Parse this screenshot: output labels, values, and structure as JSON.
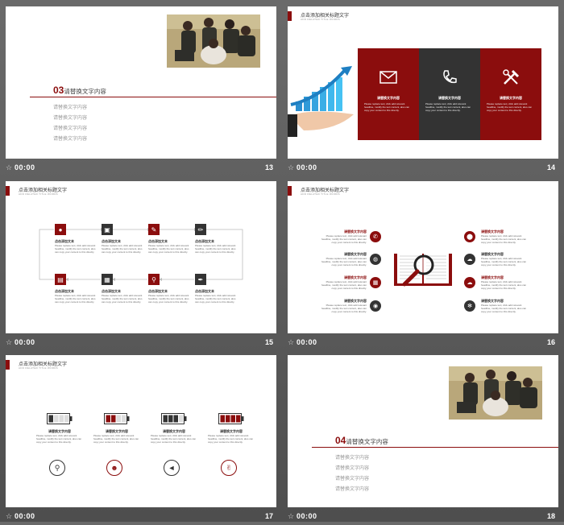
{
  "slides": [
    {
      "number": "13",
      "time": "00:00",
      "section_number": "03",
      "section_title": "请替换文字内容",
      "items": [
        "请替换文字内容",
        "请替换文字内容",
        "请替换文字内容",
        "请替换文字内容"
      ]
    },
    {
      "number": "14",
      "time": "00:00",
      "cards": [
        {
          "icon": "envelope-icon",
          "title": "请替换文字内容",
          "body": "Please replace text, click add relevant headline, modify the text content, also can copy your content to this directly."
        },
        {
          "icon": "phone-icon",
          "title": "请替换文字内容",
          "body": "Please replace text, click add relevant headline, modify the text content, also can copy your content to this directly."
        },
        {
          "icon": "tools-icon",
          "title": "请替换文字内容",
          "body": "Please replace text, click add relevant headline, modify the text content, also can copy your content to this directly."
        }
      ]
    },
    {
      "number": "15",
      "time": "00:00",
      "title": "点击添加相关标题文字",
      "subtitle": "ADD RELATED TITLE WORDS",
      "items": [
        {
          "icon": "user-icon",
          "text": "点击添加文本"
        },
        {
          "icon": "lock-icon",
          "text": "点击添加文本"
        },
        {
          "icon": "wrench-icon",
          "text": "点击添加文本"
        },
        {
          "icon": "pencil-icon",
          "text": "点击添加文本"
        },
        {
          "icon": "briefcase-icon",
          "text": "点击添加文本"
        },
        {
          "icon": "printer-icon",
          "text": "点击添加文本"
        },
        {
          "icon": "search-icon",
          "text": "点击添加文本"
        },
        {
          "icon": "pen-icon",
          "text": "点击添加文本"
        }
      ],
      "body": "Please replace text, click add relevant headline, modify the text content, also can copy your content to this directly."
    },
    {
      "number": "16",
      "time": "00:00",
      "title": "点击添加相关标题文字",
      "subtitle": "ADD RELATED TITLE WORDS",
      "left": [
        {
          "icon": "phone-icon",
          "title": "请替换文字内容"
        },
        {
          "icon": "globe-icon",
          "title": "请替换文字内容"
        },
        {
          "icon": "calendar-icon",
          "title": "请替换文字内容"
        },
        {
          "icon": "bulb-icon",
          "title": "请替换文字内容"
        }
      ],
      "right": [
        {
          "icon": "location-icon",
          "title": "请替换文字内容"
        },
        {
          "icon": "cloud-upload-icon",
          "title": "请替换文字内容"
        },
        {
          "icon": "cloud-icon",
          "title": "请替换文字内容"
        },
        {
          "icon": "gear-icon",
          "title": "请替换文字内容"
        }
      ],
      "body": "Please replace text, click add relevant headline, modify the text content, also can copy your content to this directly."
    },
    {
      "number": "17",
      "time": "00:00",
      "title": "点击添加相关标题文字",
      "subtitle": "ADD RELATED TITLE WORDS",
      "items": [
        {
          "level": 0.25,
          "title": "请替换文字内容",
          "icon": "search-icon"
        },
        {
          "level": 0.5,
          "title": "请替换文字内容",
          "icon": "users-icon"
        },
        {
          "level": 0.75,
          "title": "请替换文字内容",
          "icon": "volume-icon"
        },
        {
          "level": 1.0,
          "title": "请替换文字内容",
          "icon": "thumbs-up-icon"
        }
      ],
      "body": "Please replace text, click add relevant headline, modify the text content, also can copy your content to this directly."
    },
    {
      "number": "18",
      "time": "00:00",
      "section_number": "04",
      "section_title": "请替换文字内容",
      "items": [
        "请替换文字内容",
        "请替换文字内容",
        "请替换文字内容",
        "请替换文字内容"
      ]
    }
  ],
  "colors": {
    "accent": "#8b0d0d",
    "dark": "#333333",
    "background": "#5a5a5a"
  }
}
